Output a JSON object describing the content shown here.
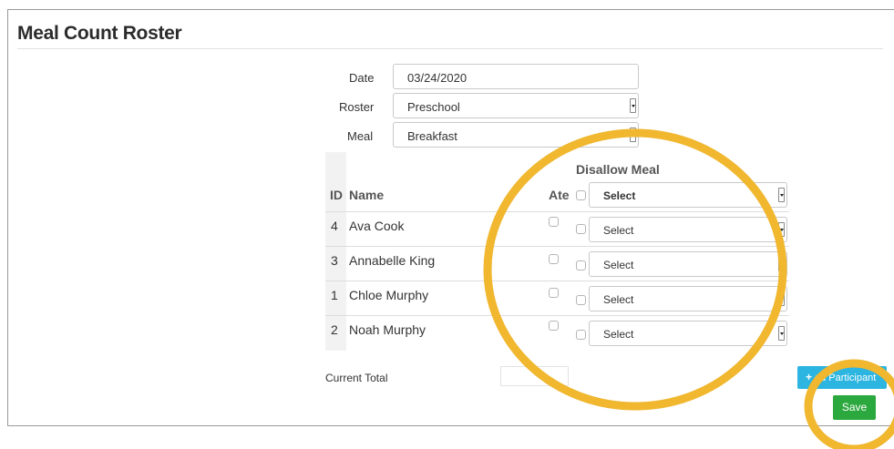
{
  "page": {
    "title": "Meal Count Roster"
  },
  "form": {
    "date_label": "Date",
    "date_value": "03/24/2020",
    "roster_label": "Roster",
    "roster_value": "Preschool",
    "meal_label": "Meal",
    "meal_value": "Breakfast"
  },
  "table": {
    "headers": {
      "id": "ID",
      "name": "Name",
      "ate": "Ate",
      "disallow": "Disallow Meal",
      "header_select": "Select"
    },
    "rows": [
      {
        "id": "4",
        "name": "Ava Cook",
        "select": "Select"
      },
      {
        "id": "3",
        "name": "Annabelle King",
        "select": "Select"
      },
      {
        "id": "1",
        "name": "Chloe Murphy",
        "select": "Select"
      },
      {
        "id": "2",
        "name": "Noah Murphy",
        "select": "Select"
      }
    ]
  },
  "footer": {
    "current_total_label": "Current Total",
    "add_participant_label": "dd Participant",
    "save_label": "Save"
  },
  "colors": {
    "annotation": "#f0b72f",
    "add_button": "#2bb5e0",
    "save_button": "#2ba83e"
  },
  "icons": {
    "add": "plus-icon",
    "select": "dropdown-arrow-icon"
  }
}
